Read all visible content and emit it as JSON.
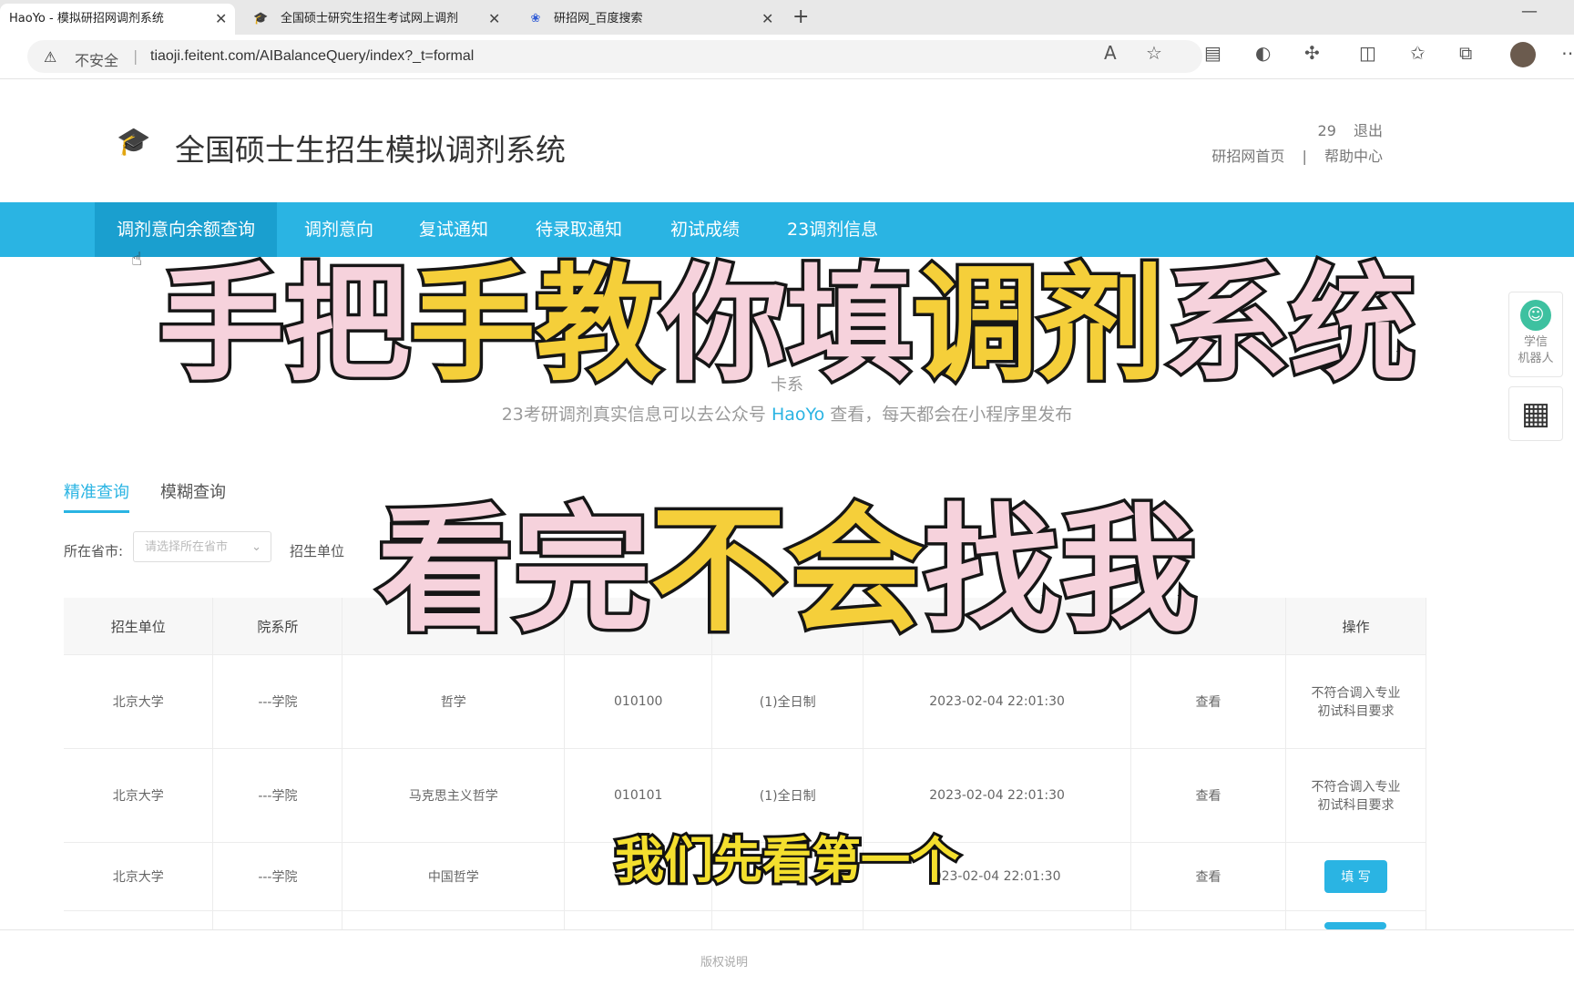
{
  "browser": {
    "tabs": [
      {
        "title": "HaoYo - 模拟研招网调剂系统",
        "active": true
      },
      {
        "title": "全国硕士研究生招生考试网上调剂",
        "active": false
      },
      {
        "title": "研招网_百度搜索",
        "active": false
      }
    ],
    "address": {
      "security_label": "不安全",
      "url": "tiaoji.feitent.com/AIBalanceQuery/index?_t=formal"
    }
  },
  "header": {
    "title": "全国硕士生招生模拟调剂系统",
    "user_count": "29",
    "logout": "退出",
    "home_link": "研招网首页",
    "divider": "|",
    "help_link": "帮助中心"
  },
  "nav": {
    "items": [
      "调剂意向余额查询",
      "调剂意向",
      "复试通知",
      "待录取通知",
      "初试成绩",
      "23调剂信息"
    ],
    "active_index": 0
  },
  "notice": {
    "line1": "卡系",
    "line2_pre": "23考研调剂真实信息可以去公众号",
    "line2_accent": "HaoYo",
    "line2_post": "查看，每天都会在小程序里发布"
  },
  "query": {
    "tabs": [
      "精准查询",
      "模糊查询"
    ],
    "province_label": "所在省市:",
    "province_placeholder": "请选择所在省市",
    "unit_label": "招生单位"
  },
  "table": {
    "headers": [
      "招生单位",
      "院系所",
      "",
      "",
      "",
      "",
      "",
      "操作"
    ],
    "rows": [
      {
        "unit": "北京大学",
        "dept": "---学院",
        "major": "哲学",
        "code": "010100",
        "mode": "(1)全日制",
        "time": "2023-02-04 22:01:30",
        "view": "查看",
        "op1": "不符合调入专业",
        "op2": "初试科目要求"
      },
      {
        "unit": "北京大学",
        "dept": "---学院",
        "major": "马克思主义哲学",
        "code": "010101",
        "mode": "(1)全日制",
        "time": "2023-02-04 22:01:30",
        "view": "查看",
        "op1": "不符合调入专业",
        "op2": "初试科目要求"
      },
      {
        "unit": "北京大学",
        "dept": "---学院",
        "major": "中国哲学",
        "code": "",
        "mode": "",
        "time": "023-02-04 22:01:30",
        "view": "查看",
        "button": "填 写"
      }
    ]
  },
  "footer": {
    "text": "版权说明"
  },
  "side": {
    "robot_label_1": "学信",
    "robot_label_2": "机器人"
  },
  "overlay": {
    "line1_parts": [
      {
        "text": "手把",
        "color": "pink"
      },
      {
        "text": "手教",
        "color": "yellow"
      },
      {
        "text": "你填",
        "color": "pink"
      },
      {
        "text": "调剂",
        "color": "yellow"
      },
      {
        "text": "系统",
        "color": "pink"
      }
    ],
    "line2_parts": [
      {
        "text": "看完",
        "color": "pink"
      },
      {
        "text": "不会",
        "color": "yellow"
      },
      {
        "text": "找我",
        "color": "pink"
      }
    ],
    "subtitle": "我们先看第一个"
  }
}
